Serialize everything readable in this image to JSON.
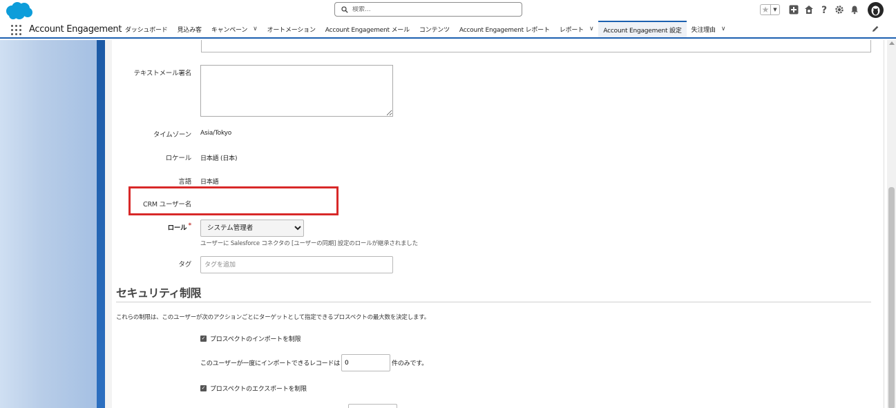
{
  "header": {
    "search_placeholder": "検索...",
    "icons": [
      "salesforce-cloud-logo",
      "favorite-star-icon",
      "favorites-dropdown-icon",
      "global-actions-plus-icon",
      "trailhead-guidance-icon",
      "help-question-icon",
      "setup-gear-icon",
      "notification-bell-icon",
      "user-avatar"
    ],
    "brand_color": "#0d9dda"
  },
  "nav": {
    "app_name": "Account Engagement",
    "items": [
      {
        "label": "ダッシュボード",
        "has_menu": false
      },
      {
        "label": "見込み客",
        "has_menu": false
      },
      {
        "label": "キャンペーン",
        "has_menu": true
      },
      {
        "label": "オートメーション",
        "has_menu": false
      },
      {
        "label": "Account Engagement メール",
        "has_menu": false
      },
      {
        "label": "コンテンツ",
        "has_menu": false
      },
      {
        "label": "Account Engagement レポート",
        "has_menu": false
      },
      {
        "label": "レポート",
        "has_menu": true
      },
      {
        "label": "Account Engagement 設定",
        "has_menu": false,
        "active": true
      },
      {
        "label": "失注理由",
        "has_menu": true
      }
    ],
    "accent_color": "#1b5fb0"
  },
  "form": {
    "text_signature_label": "テキストメール署名",
    "timezone_label": "タイムゾーン",
    "timezone_value": "Asia/Tokyo",
    "locale_label": "ロケール",
    "locale_value": "日本語 (日本)",
    "language_label": "言語",
    "language_value": "日本語",
    "crm_username_label": "CRM ユーザー名",
    "crm_username_value": "",
    "role_label": "ロール",
    "role_required": "*",
    "role_selected": "システム管理者",
    "role_help": "ユーザーに Salesforce コネクタの [ユーザーの同期] 設定のロールが継承されました",
    "tag_label": "タグ",
    "tag_placeholder": "タグを追加",
    "highlight_color": "#d82828"
  },
  "security": {
    "title": "セキュリティ制限",
    "description": "これらの制限は、このユーザーが次のアクションごとにターゲットとして指定できるプロスペクトの最大数を決定します。",
    "limit_import_label": "プロスペクトのインポートを制限",
    "limit_import_checked": true,
    "import_limit_prefix": "このユーザーが一度にインポートできるレコードは",
    "import_limit_value": "0",
    "import_limit_suffix": "件のみです。",
    "limit_export_label": "プロスペクトのエクスポートを制限",
    "limit_export_checked": true
  }
}
